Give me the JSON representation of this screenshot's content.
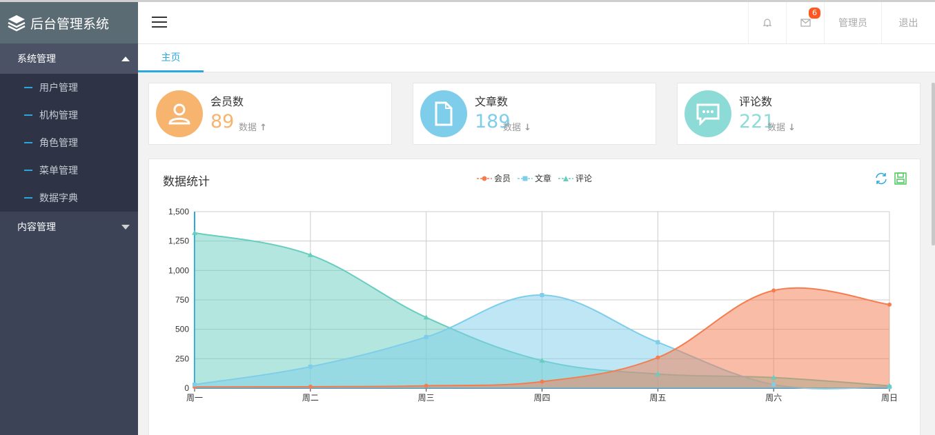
{
  "app": {
    "title": "后台管理系统"
  },
  "sidebar": {
    "groups": [
      {
        "label": "系统管理",
        "items": [
          "用户管理",
          "机构管理",
          "角色管理",
          "菜单管理",
          "数据字典"
        ]
      },
      {
        "label": "内容管理",
        "items": []
      }
    ]
  },
  "header": {
    "mail_count": "6",
    "user": "管理员",
    "logout": "退出"
  },
  "tabs": [
    {
      "label": "主页"
    }
  ],
  "stats": [
    {
      "title": "会员数",
      "value": "89",
      "trend": "数据",
      "color": "#f7b46e"
    },
    {
      "title": "文章数",
      "value": "189",
      "trend": "数据",
      "color": "#7ecdea"
    },
    {
      "title": "评论数",
      "value": "221",
      "trend": "数据",
      "color": "#8ddbd7"
    }
  ],
  "chart_data": {
    "type": "area",
    "title": "数据统计",
    "categories": [
      "周一",
      "周二",
      "周三",
      "周四",
      "周五",
      "周六",
      "周日"
    ],
    "ylim": [
      0,
      1500
    ],
    "yticks": [
      "0",
      "250",
      "500",
      "750",
      "1,000",
      "1,250",
      "1,500"
    ],
    "grid": true,
    "legend_position": "top-center",
    "series": [
      {
        "name": "会员",
        "values": [
          10,
          12,
          20,
          55,
          260,
          830,
          710
        ],
        "color": "#f47c4f"
      },
      {
        "name": "文章",
        "values": [
          30,
          182,
          434,
          791,
          390,
          30,
          10
        ],
        "color": "#7ecdea"
      },
      {
        "name": "评论",
        "values": [
          1320,
          1132,
          601,
          234,
          120,
          90,
          20
        ],
        "color": "#67cdbe"
      }
    ]
  }
}
